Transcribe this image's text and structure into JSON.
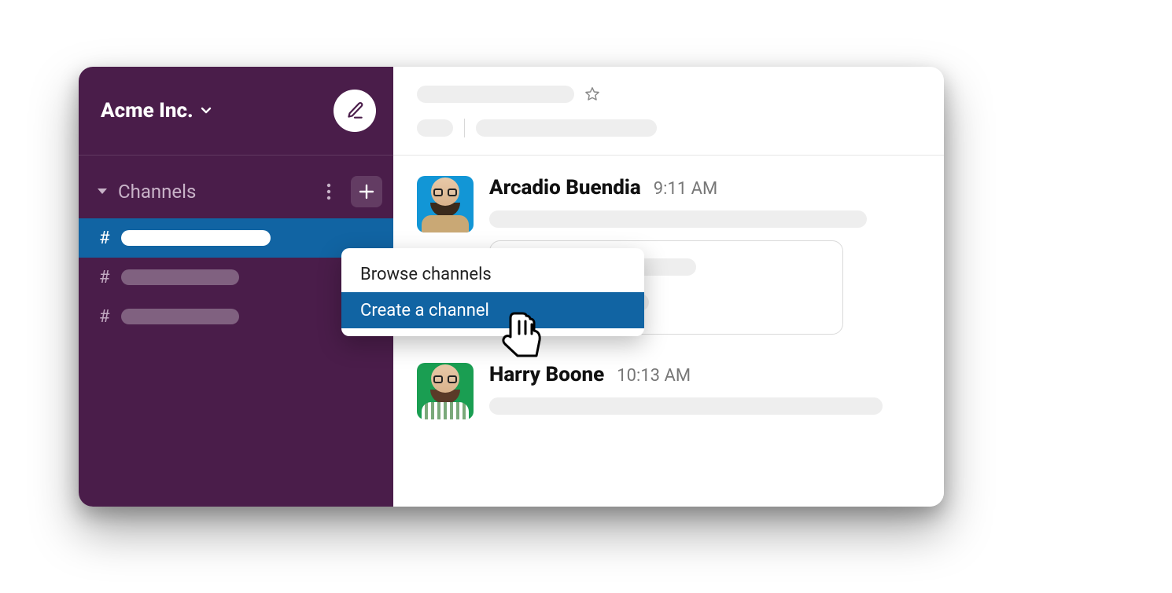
{
  "sidebar": {
    "workspace_name": "Acme Inc.",
    "section_label": "Channels",
    "hash_symbol": "#"
  },
  "dropdown": {
    "items": [
      {
        "label": "Browse channels"
      },
      {
        "label": "Create a channel"
      }
    ]
  },
  "messages": [
    {
      "sender": "Arcadio Buendia",
      "time": "9:11 AM"
    },
    {
      "sender": "Harry Boone",
      "time": "10:13 AM"
    }
  ]
}
